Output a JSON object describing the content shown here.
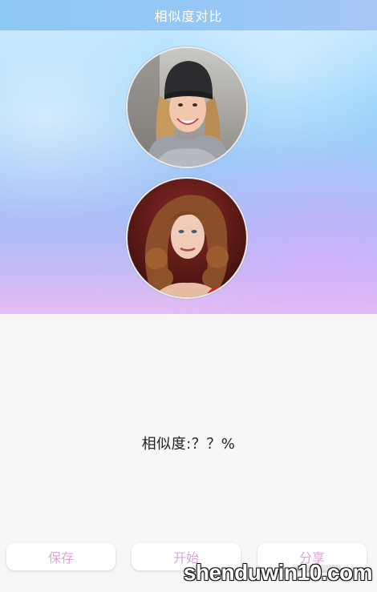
{
  "header": {
    "title": "相似度对比"
  },
  "photos": [
    {
      "icon": "woman-beanie-photo"
    },
    {
      "icon": "woman-curly-hair-photo"
    }
  ],
  "result": {
    "text": "相似度:？？%"
  },
  "actions": {
    "save_label": "保存",
    "start_label": "开始",
    "share_label": "分享"
  },
  "watermark": {
    "text": "shenduwin10.com"
  },
  "colors": {
    "button_text": "#e0a3dc",
    "topbar": "#94c6f6"
  }
}
